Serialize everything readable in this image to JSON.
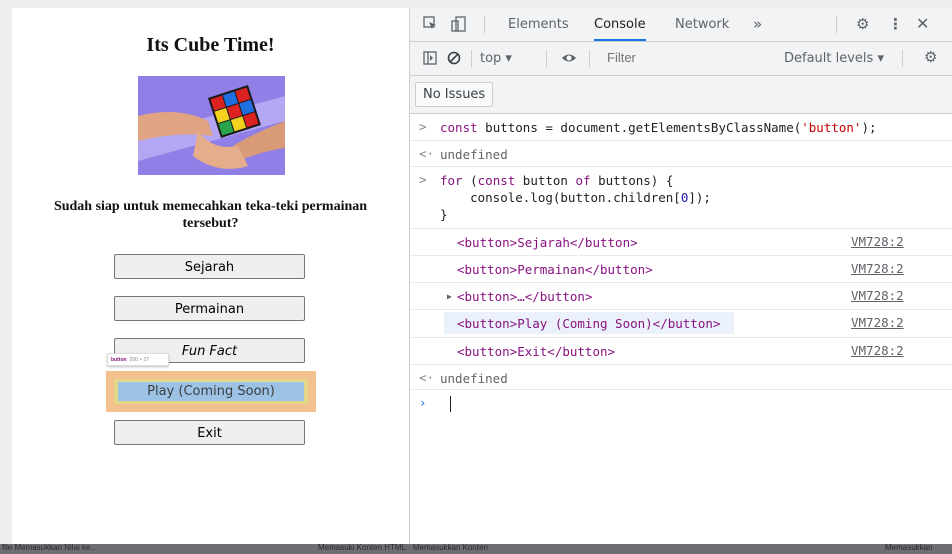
{
  "page": {
    "title": "Its Cube Time!",
    "question": "Sudah siap untuk memecahkan teka-teki permainan tersebut?",
    "buttons": [
      "Sejarah",
      "Permainan",
      "Fun Fact",
      "Play (Coming Soon)",
      "Exit"
    ],
    "tooltip": {
      "tag": "button",
      "size": "200 × 27"
    }
  },
  "devtools": {
    "tabs": [
      "Elements",
      "Console",
      "Network"
    ],
    "more_tabs": "»",
    "context": "top ▾",
    "filter_placeholder": "Filter",
    "levels": "Default levels ▾",
    "issues": "No Issues",
    "console": {
      "cmd1": {
        "kw": "const",
        "a": " buttons = document.getElementsByClassName(",
        "str": "'button'",
        "b": ");"
      },
      "result1": "undefined",
      "cmd2": {
        "kw1": "for",
        "a": " (",
        "kw2": "const",
        "b": " button ",
        "kw3": "of",
        "c": " buttons) {",
        "line2a": "    console.log(button.children[",
        "num": "0",
        "line2b": "]);",
        "line3": "}"
      },
      "logs": [
        {
          "text": "<button>Sejarah</button>",
          "source": "VM728:2"
        },
        {
          "text": "<button>Permainan</button>",
          "source": "VM728:2"
        },
        {
          "text": "<button>…</button>",
          "source": "VM728:2"
        },
        {
          "text": "<button>Play (Coming Soon)</button>",
          "source": "VM728:2"
        },
        {
          "text": "<button>Exit</button>",
          "source": "VM728:2"
        }
      ],
      "result2": "undefined"
    }
  },
  "bottom_strip": [
    "file Memasukkan Nilai ke...",
    "Memasuki Konten HTML · Memasukkan Konten",
    "Memasukkan"
  ],
  "colors": {
    "accent": "#1a73e8",
    "highlight_margin": "#f2c18d",
    "highlight_content": "#9cc3e6"
  }
}
